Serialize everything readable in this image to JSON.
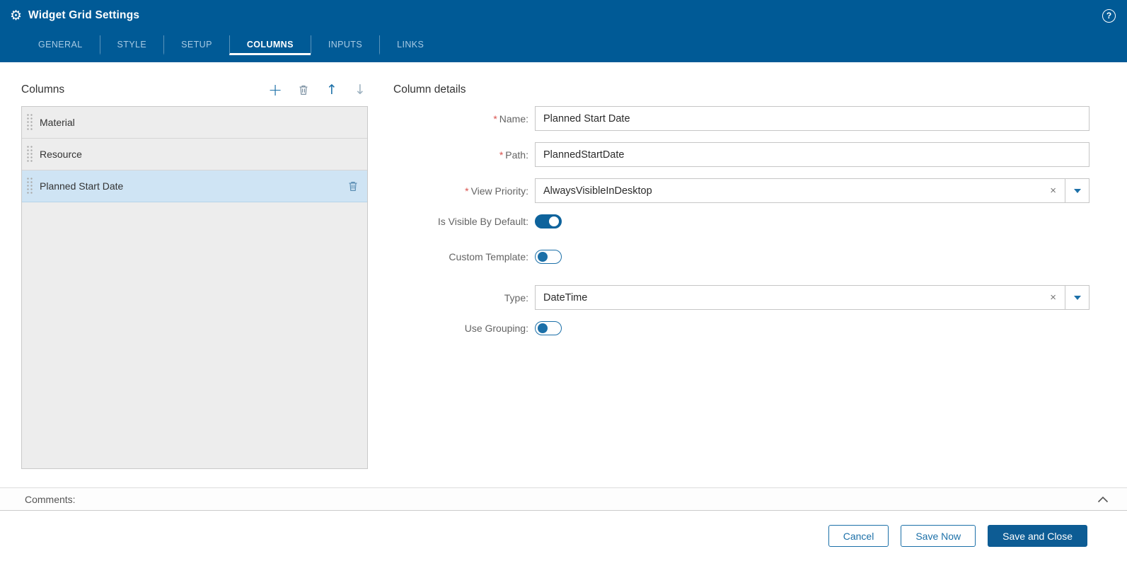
{
  "colors": {
    "header-bg": "#005a96",
    "accent": "#1c70a8",
    "toggle-on-bg": "#0e639c",
    "primary-btn-bg": "#0d5c94",
    "selected-row-bg": "#cfe4f4",
    "required": "#d9534f"
  },
  "header": {
    "title": "Widget Grid Settings",
    "gear_icon": "⚙",
    "help_glyph": "?"
  },
  "tabs": [
    {
      "label": "GENERAL",
      "active": false
    },
    {
      "label": "STYLE",
      "active": false
    },
    {
      "label": "SETUP",
      "active": false
    },
    {
      "label": "COLUMNS",
      "active": true
    },
    {
      "label": "INPUTS",
      "active": false
    },
    {
      "label": "LINKS",
      "active": false
    }
  ],
  "columns_panel": {
    "title": "Columns",
    "toolbar": {
      "add_glyph": "+",
      "move_up_glyph": "↑",
      "move_down_glyph": "↓"
    },
    "items": [
      {
        "label": "Material",
        "selected": false
      },
      {
        "label": "Resource",
        "selected": false
      },
      {
        "label": "Planned Start Date",
        "selected": true
      }
    ]
  },
  "details_panel": {
    "title": "Column details",
    "required_marker": "*",
    "fields": {
      "name": {
        "label": "Name:",
        "required": true,
        "value": "Planned Start Date"
      },
      "path": {
        "label": "Path:",
        "required": true,
        "value": "PlannedStartDate"
      },
      "view_priority": {
        "label": "View Priority:",
        "required": true,
        "value": "AlwaysVisibleInDesktop",
        "clear_glyph": "×"
      },
      "is_visible_by_default": {
        "label": "Is Visible By Default:",
        "on": true
      },
      "custom_template": {
        "label": "Custom Template:",
        "on": false
      },
      "type": {
        "label": "Type:",
        "required": false,
        "value": "DateTime",
        "clear_glyph": "×"
      },
      "use_grouping": {
        "label": "Use Grouping:",
        "on": false
      }
    }
  },
  "comments": {
    "label": "Comments:"
  },
  "footer": {
    "cancel_label": "Cancel",
    "save_now_label": "Save Now",
    "save_and_close_label": "Save and Close"
  }
}
